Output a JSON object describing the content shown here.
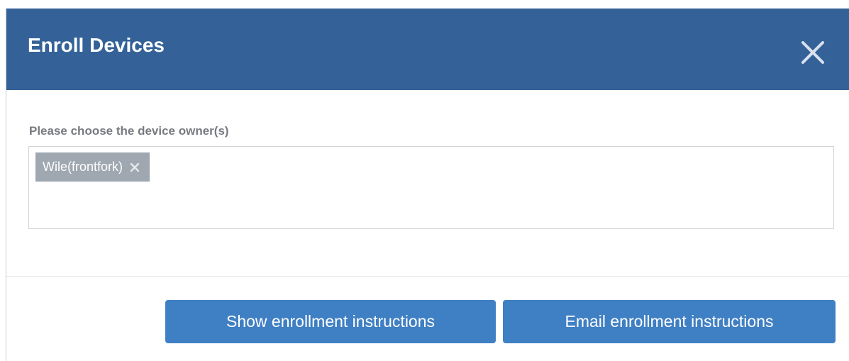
{
  "dialog": {
    "title": "Enroll Devices",
    "close_icon": "close-icon"
  },
  "owner_field": {
    "label": "Please choose the device owner(s)",
    "tags": [
      {
        "label": "Wile(frontfork)",
        "remove_icon": "remove-tag-icon"
      }
    ]
  },
  "actions": {
    "show_label": "Show enrollment instructions",
    "email_label": "Email enrollment instructions"
  },
  "colors": {
    "header_bg": "#346298",
    "button_bg": "#3f7fc4",
    "tag_bg": "#9fa8b0"
  }
}
